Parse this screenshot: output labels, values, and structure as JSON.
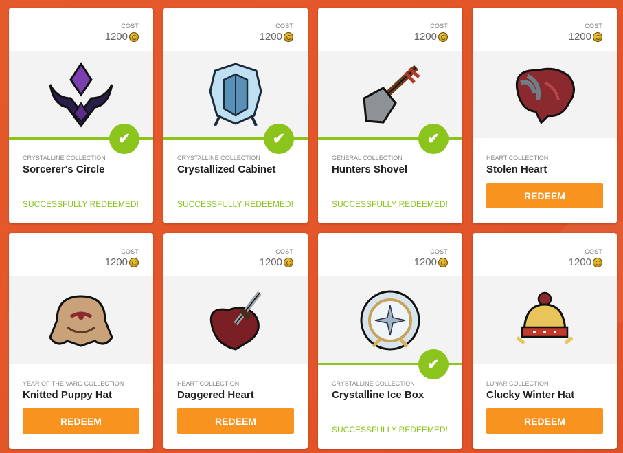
{
  "cards": [
    {
      "cost_label": "COST",
      "cost": "1200",
      "collection": "CRYSTALLINE COLLECTION",
      "name": "Sorcerer's Circle",
      "status": "SUCCESSFULLY REDEEMED!",
      "redeemed": true,
      "icon": "sorcerers-circle-icon"
    },
    {
      "cost_label": "COST",
      "cost": "1200",
      "collection": "CRYSTALLINE COLLECTION",
      "name": "Crystallized Cabinet",
      "status": "SUCCESSFULLY REDEEMED!",
      "redeemed": true,
      "icon": "crystallized-cabinet-icon"
    },
    {
      "cost_label": "COST",
      "cost": "1200",
      "collection": "GENERAL COLLECTION",
      "name": "Hunters Shovel",
      "status": "SUCCESSFULLY REDEEMED!",
      "redeemed": true,
      "icon": "shovel-icon"
    },
    {
      "cost_label": "COST",
      "cost": "1200",
      "collection": "HEART COLLECTION",
      "name": "Stolen Heart",
      "button": "REDEEM",
      "redeemed": false,
      "icon": "heart-icon"
    },
    {
      "cost_label": "COST",
      "cost": "1200",
      "collection": "YEAR OF THE VARG COLLECTION",
      "name": "Knitted Puppy Hat",
      "button": "REDEEM",
      "redeemed": false,
      "icon": "puppy-hat-icon"
    },
    {
      "cost_label": "COST",
      "cost": "1200",
      "collection": "HEART COLLECTION",
      "name": "Daggered Heart",
      "button": "REDEEM",
      "redeemed": false,
      "icon": "daggered-heart-icon"
    },
    {
      "cost_label": "COST",
      "cost": "1200",
      "collection": "CRYSTALLINE COLLECTION",
      "name": "Crystalline Ice Box",
      "status": "SUCCESSFULLY REDEEMED!",
      "redeemed": true,
      "icon": "ice-box-icon"
    },
    {
      "cost_label": "COST",
      "cost": "1200",
      "collection": "LUNAR COLLECTION",
      "name": "Clucky Winter Hat",
      "button": "REDEEM",
      "redeemed": false,
      "icon": "winter-hat-icon"
    }
  ],
  "colors": {
    "accent_orange": "#f7931e",
    "success_green": "#8bc41d",
    "background": "#e4572b"
  }
}
